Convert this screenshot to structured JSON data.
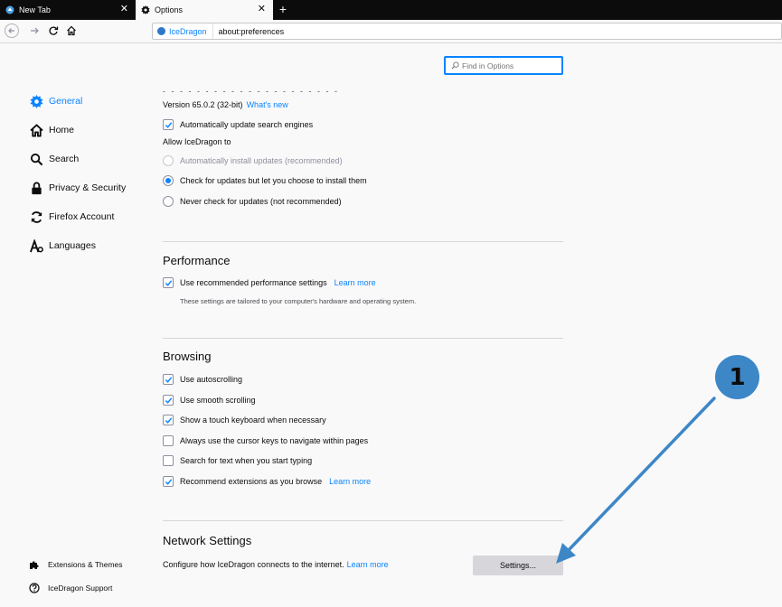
{
  "browser": {
    "tabs": [
      {
        "title": "New Tab",
        "active": false
      },
      {
        "title": "Options",
        "active": true
      }
    ],
    "new_tab_symbol": "+",
    "close_symbol": "✕",
    "url_identity": "IceDragon",
    "url": "about:preferences"
  },
  "search": {
    "placeholder": "Find in Options"
  },
  "sidebar": {
    "items": [
      {
        "label": "General",
        "icon": "gear-icon",
        "selected": true
      },
      {
        "label": "Home",
        "icon": "home-icon"
      },
      {
        "label": "Search",
        "icon": "search-icon"
      },
      {
        "label": "Privacy & Security",
        "icon": "lock-icon"
      },
      {
        "label": "Firefox Account",
        "icon": "sync-icon"
      },
      {
        "label": "Languages",
        "icon": "language-icon"
      }
    ],
    "footer": [
      {
        "label": "Extensions & Themes",
        "icon": "puzzle-icon"
      },
      {
        "label": "IceDragon Support",
        "icon": "help-icon"
      }
    ]
  },
  "updates": {
    "truncated_text": "- - - - - - - - - - - - - - - - - - - - -",
    "version": "Version 65.0.2 (32-bit)",
    "whats_new": "What's new",
    "auto_update_search": {
      "label": "Automatically update search engines",
      "checked": true
    },
    "allow_label": "Allow IceDragon to",
    "options": [
      {
        "label": "Automatically install updates (recommended)",
        "checked": false,
        "disabled": true
      },
      {
        "label": "Check for updates but let you choose to install them",
        "checked": true,
        "disabled": false
      },
      {
        "label": "Never check for updates (not recommended)",
        "checked": false,
        "disabled": false
      }
    ]
  },
  "performance": {
    "title": "Performance",
    "recommended": {
      "label": "Use recommended performance settings",
      "checked": true
    },
    "learn_more": "Learn more",
    "note": "These settings are tailored to your computer's hardware and operating system."
  },
  "browsing": {
    "title": "Browsing",
    "options": [
      {
        "label": "Use autoscrolling",
        "checked": true
      },
      {
        "label": "Use smooth scrolling",
        "checked": true
      },
      {
        "label": "Show a touch keyboard when necessary",
        "checked": true
      },
      {
        "label": "Always use the cursor keys to navigate within pages",
        "checked": false
      },
      {
        "label": "Search for text when you start typing",
        "checked": false
      },
      {
        "label": "Recommend extensions as you browse",
        "checked": true,
        "learn_more": "Learn more"
      }
    ]
  },
  "network": {
    "title": "Network Settings",
    "description": "Configure how IceDragon connects to the internet.",
    "learn_more": "Learn more",
    "settings_button": "Settings..."
  },
  "annotation": {
    "number": "1",
    "color": "#3d87c7"
  },
  "colors": {
    "accent": "#0a84ff",
    "tabstrip": "#0c0c0d",
    "background": "#f9f9fa"
  }
}
